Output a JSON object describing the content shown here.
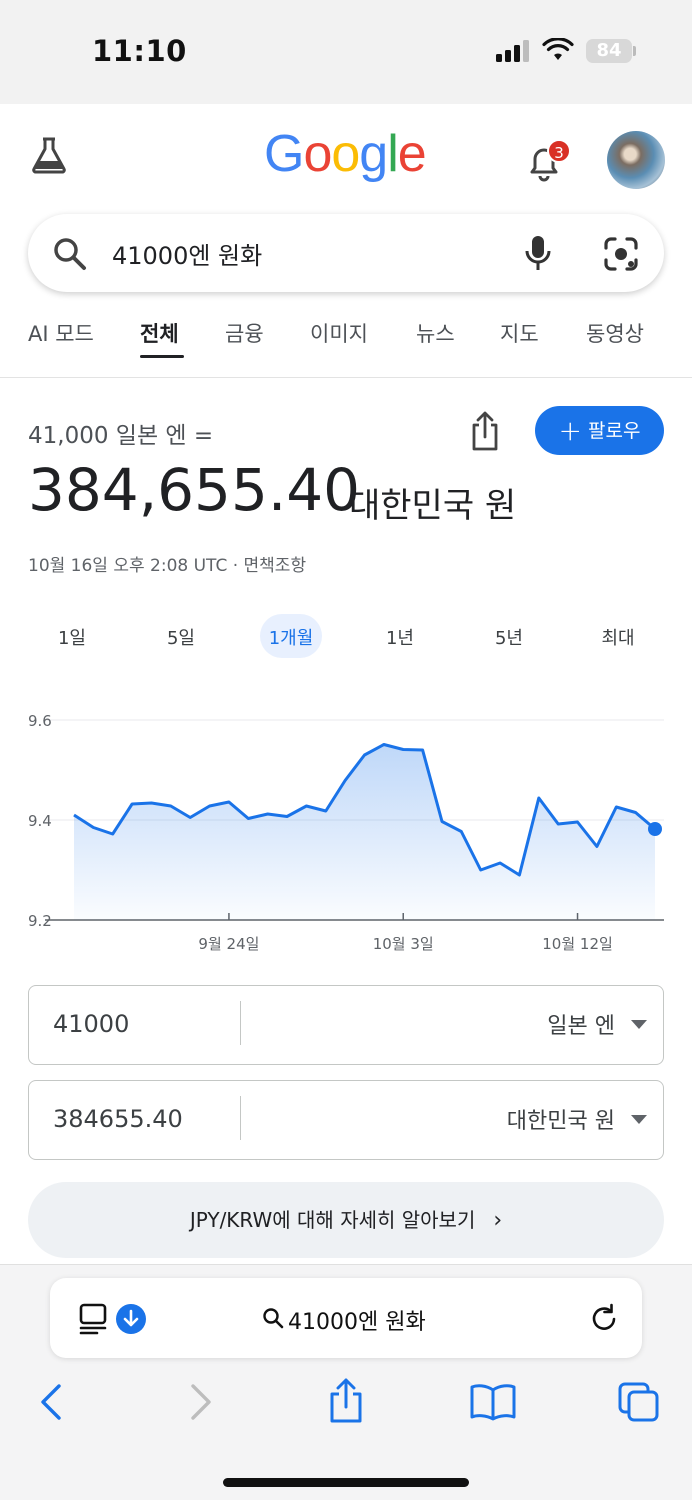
{
  "status_bar": {
    "time": "11:10",
    "battery": "84"
  },
  "header": {
    "logo": [
      "G",
      "o",
      "o",
      "g",
      "l",
      "e"
    ],
    "logo_colors": [
      "#4285F4",
      "#EA4335",
      "#FBBC05",
      "#4285F4",
      "#34A853",
      "#EA4335"
    ],
    "notification_count": "3"
  },
  "search": {
    "query": "41000엔 원화"
  },
  "tabs": [
    {
      "label": "AI 모드",
      "active": false
    },
    {
      "label": "전체",
      "active": true
    },
    {
      "label": "금융",
      "active": false
    },
    {
      "label": "이미지",
      "active": false
    },
    {
      "label": "뉴스",
      "active": false
    },
    {
      "label": "지도",
      "active": false
    },
    {
      "label": "동영상",
      "active": false
    }
  ],
  "converter": {
    "from_line": "41,000 일본 엔 =",
    "result_value": "384,655.40",
    "result_unit": "대한민국 원",
    "timestamp": "10월 16일 오후 2:08 UTC · 면책조항",
    "follow_label": "팔로우",
    "from_value": "41000",
    "from_currency": "일본 엔",
    "to_value": "384655.40",
    "to_currency": "대한민국 원",
    "learn_more": "JPY/KRW에 대해 자세히 알아보기"
  },
  "ranges": [
    "1일",
    "5일",
    "1개월",
    "1년",
    "5년",
    "최대"
  ],
  "active_range": "1개월",
  "chart_data": {
    "type": "area",
    "y_ticks": [
      "9.6",
      "9.4",
      "9.2"
    ],
    "ylim": [
      9.2,
      9.6
    ],
    "x_ticks": [
      "9월 24일",
      "10월 3일",
      "10월 12일"
    ],
    "line_color": "#1a73e8",
    "grid": true,
    "series": [
      {
        "values": [
          9.41,
          9.385,
          9.372,
          9.432,
          9.434,
          9.428,
          9.405,
          9.428,
          9.436,
          9.403,
          9.412,
          9.407,
          9.428,
          9.418,
          9.479,
          9.53,
          9.551,
          9.541,
          9.54,
          9.397,
          9.377,
          9.3,
          9.314,
          9.29,
          9.444,
          9.392,
          9.396,
          9.347,
          9.426,
          9.415,
          9.382
        ]
      }
    ]
  },
  "browser": {
    "url_text": "41000엔 원화"
  }
}
